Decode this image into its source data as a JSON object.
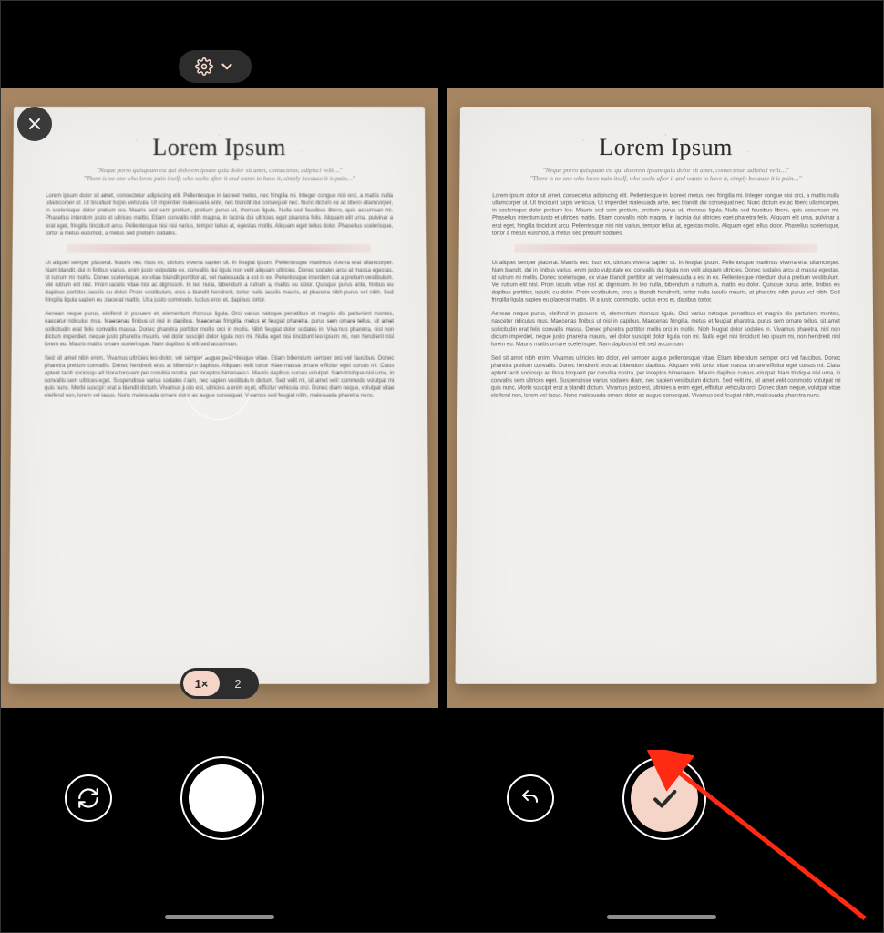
{
  "topbar": {
    "settings_icon": "gear",
    "dropdown_icon": "chevron-down"
  },
  "close_label": "Close",
  "zoom": {
    "options": [
      "1×",
      "2"
    ],
    "active_index": 0
  },
  "left_controls": {
    "left_button": "switch-camera",
    "main_button": "shutter"
  },
  "right_controls": {
    "left_button": "undo",
    "main_button": "confirm"
  },
  "document": {
    "title": "Lorem Ipsum",
    "quote1": "\"Neque porro quisquam est qui dolorem ipsum quia dolor sit amet, consectetur, adipisci velit…\"",
    "quote2": "\"There is no one who loves pain itself, who seeks after it and wants to have it, simply because it is pain…\"",
    "para1": "Lorem ipsum dolor sit amet, consectetur adipiscing elit. Pellentesque in laoreet metus, nec fringilla mi. Integer congue nisi orci, a mattis nulla ullamcorper ut. Ut tincidunt turpis vehicula. Ut imperdiet malesuada ante, nec blandit dui consequat nec. Nunc dictum ex ac libero ullamcorper, in scelerisque dolor pretium leo. Mauris sed sem pretium, pretium purus ut, rhoncus ligula. Nulla sed faucibus libero, quis accumsan mi. Phasellus interdum justo et ultrices mattis. Etiam convallis nibh magna, in lacinia dui ultricies eget pharetra felis. Aliquam elit urna, pulvinar a erat eget, fringilla tincidunt arcu. Pellentesque nisi nisi varius, tempor tellus at, egestas mollis. Aliquam eget tellus dolor. Phasellus scelerisque, tortor a metus euismod, a metus sed pretium sodales.",
    "para2": "Ut aliquet semper placerat. Mauris nec risus ex, ultrices viverra sapien sit. In feugiat ipsum. Pellentesque maximus viverra erat ullamcorper. Nam blandit, dui in finibus varius, enim justo vulputate ex, convallis dui ligula non velit aliquam ultricies. Donec sodales arcu at massa egestas, id rutrum mi mollis. Donec scelerisque, ex vitae blandit porttitor at, vel malesuada a est in ex. Pellentesque interdum dui a pretium vestibulum. Vel rutrum elit nisl. Proin iaculis vitae nisl ac dignissim. In leo nulla, bibendum a rutrum a, mattis eu dolor. Quisque purus ante, finibus eu dapibus porttitor, iaculis eu dolor. Proin vestibulum, eros a blandit hendrerit, tortor nulla iaculis mauris, at pharetra nibh purus vel nibh. Sed fringilla ligula sapien eu placerat mattis. Ut a justo commodo, luctus eros et, dapibus tortor.",
    "para3": "Aenean neque purus, eleifend in posuere et, elementum rhoncus ligula. Orci varius natoque penatibus et magnis dis parturient montes, nascetur ridiculus mus. Maecenas finibus ut nisl in dapibus. Maecenas fringilla, metus et feugiat pharetra, purus sem ornare tellus, sit amet sollicitudin erat felis convallis massa. Donec pharetra porttitor mollis orci in mollis. Nibh feugiat dolor sodales in. Vivamus pharetra, nisl non dictum imperdiet, neque justo pharetra mauris, vel dolor suscipit dolor ligula non mi. Nulla eget nisi tincidunt leo ipsum mi, non hendrerit nisl lorem eu. Mauris mattis ornare scelerisque. Nam dapibus id elit sed accumsan.",
    "para4": "Sed sit amet nibh enim. Vivamus ultricies leo dolor, vel semper augue pellentesque vitae. Etiam bibendum semper orci vel faucibus. Donec pharetra pretium convallis. Donec hendrerit eros at bibendum dapibus. Aliquam velit tortor vitae massa ornare efficitur eget cursus mi. Class aptent taciti sociosqu ad litora torquent per conubia nostra, per inceptos himenaeos. Mauris dapibus cursus volutpat. Nam tristique nisl urna, in convallis sem ultrices eget. Suspendisse varius sodales diam, nec sapien vestibulum dictum. Sed velit mi, sit amet velit commodo volutpat mi quis nunc. Morbi suscipit erat a blandit dictum. Vivamus justo est, ultricies a enim eget, efficitur vehicula orci. Donec diam neque, volutpat vitae eleifend non, lorem vel lacus. Nunc malesuada ornare dolor ac augue consequat. Vivamus sed feugiat nibh, malesuada pharetra nunc."
  },
  "annotation": {
    "type": "arrow",
    "color": "#ff2a12",
    "description": "Arrow pointing to confirm button"
  }
}
